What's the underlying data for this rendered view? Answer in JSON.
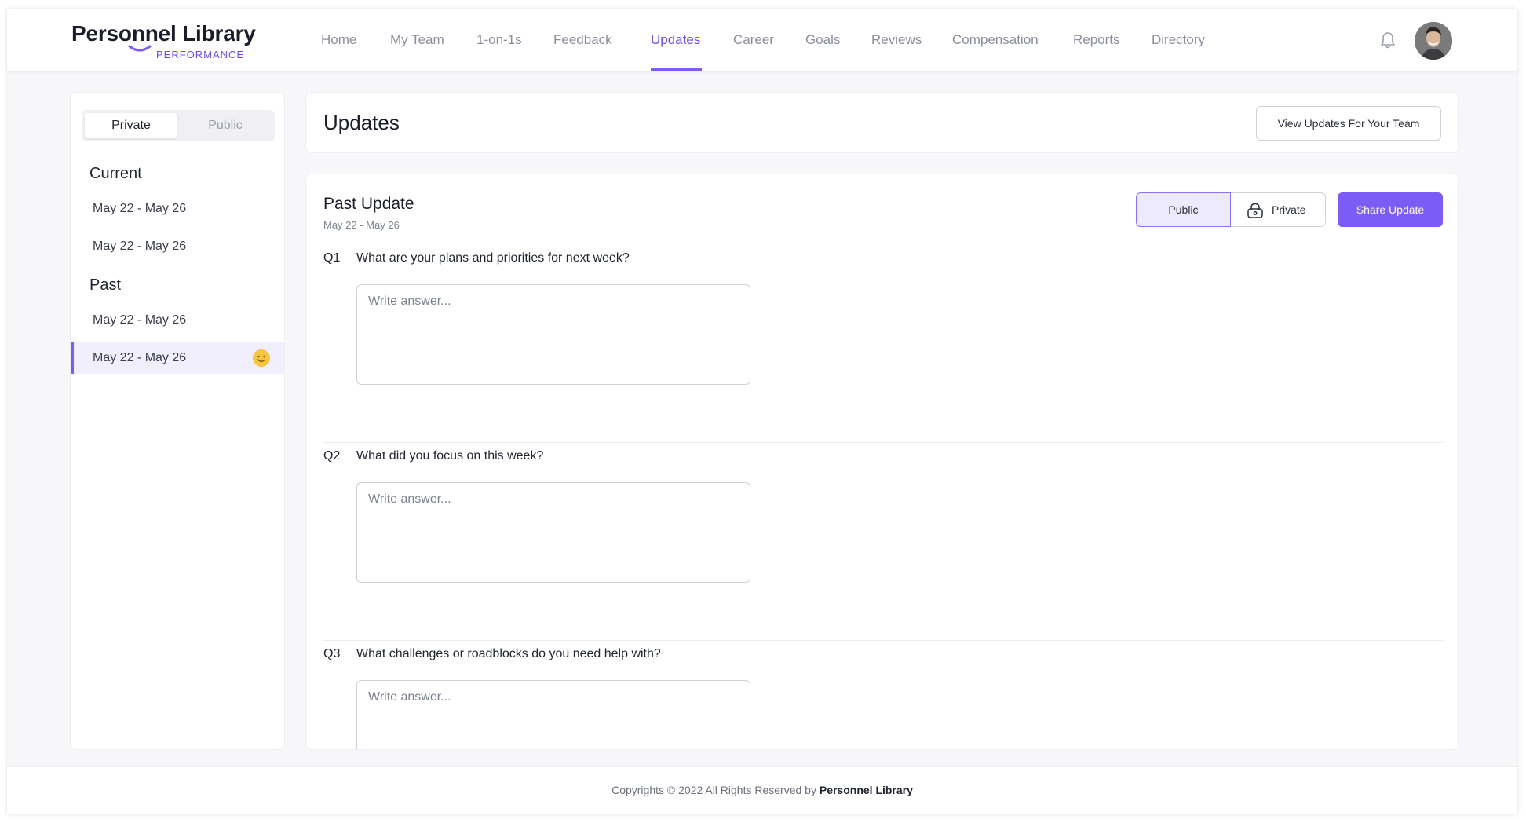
{
  "brand": {
    "name": "Personnel Library",
    "sub": "PERFORMANCE",
    "accent": "#7c5cf5"
  },
  "nav": {
    "items": [
      {
        "label": "Home"
      },
      {
        "label": "My Team"
      },
      {
        "label": "1-on-1s"
      },
      {
        "label": "Feedback"
      },
      {
        "label": "Updates",
        "active": true
      },
      {
        "label": "Career"
      },
      {
        "label": "Goals"
      },
      {
        "label": "Reviews"
      },
      {
        "label": "Compensation"
      },
      {
        "label": "Reports"
      },
      {
        "label": "Directory"
      }
    ],
    "icons": [
      "bell-icon",
      "avatar"
    ]
  },
  "sidebar": {
    "toggle": {
      "selected": "Private",
      "other": "Public"
    },
    "current_heading": "Current",
    "current_items": [
      "May 22 - May 26",
      "May 22 - May 26"
    ],
    "past_heading": "Past",
    "past_items": [
      "May 22 - May 26",
      "May 22 - May 26"
    ],
    "selected_icon": "smile-emoji-icon"
  },
  "page": {
    "title": "Updates",
    "view_team_button": "View Updates For Your Team"
  },
  "update": {
    "title": "Past Update",
    "date_range": "May 22 - May 26",
    "visibility": {
      "public_label": "Public",
      "private_label": "Private",
      "selected": "Public"
    },
    "share_button": "Share Update",
    "questions": [
      {
        "num": "Q1",
        "text": "What are your plans and priorities for next week?",
        "placeholder": "Write answer..."
      },
      {
        "num": "Q2",
        "text": "What did you focus on this week?",
        "placeholder": "Write answer..."
      },
      {
        "num": "Q3",
        "text": "What challenges or roadblocks do you need help with?",
        "placeholder": "Write answer..."
      }
    ]
  },
  "footer": {
    "prefix": "Copyrights © 2022 All Rights Reserved by ",
    "brand": "Personnel Library"
  }
}
